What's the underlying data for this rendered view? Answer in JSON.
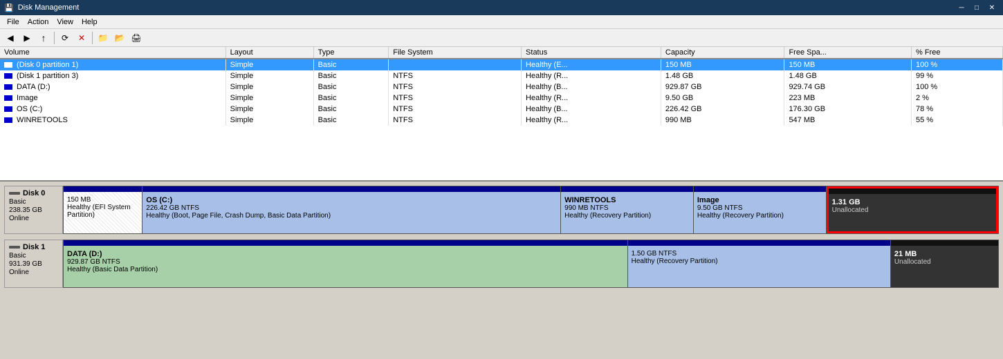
{
  "titleBar": {
    "title": "Disk Management",
    "minimize": "─",
    "maximize": "□",
    "close": "✕"
  },
  "menuBar": {
    "items": [
      "File",
      "Action",
      "View",
      "Help"
    ]
  },
  "toolbar": {
    "buttons": [
      "◀",
      "▶",
      "↑",
      "⬛",
      "✕",
      "📁",
      "📂",
      "🖨"
    ]
  },
  "table": {
    "columns": [
      "Volume",
      "Layout",
      "Type",
      "File System",
      "Status",
      "Capacity",
      "Free Spa...",
      "% Free"
    ],
    "rows": [
      {
        "volume": "(Disk 0 partition 1)",
        "layout": "Simple",
        "type": "Basic",
        "fs": "",
        "status": "Healthy (E...",
        "capacity": "150 MB",
        "free": "150 MB",
        "pct": "100 %",
        "selected": true
      },
      {
        "volume": "(Disk 1 partition 3)",
        "layout": "Simple",
        "type": "Basic",
        "fs": "NTFS",
        "status": "Healthy (R...",
        "capacity": "1.48 GB",
        "free": "1.48 GB",
        "pct": "99 %",
        "selected": false
      },
      {
        "volume": "DATA (D:)",
        "layout": "Simple",
        "type": "Basic",
        "fs": "NTFS",
        "status": "Healthy (B...",
        "capacity": "929.87 GB",
        "free": "929.74 GB",
        "pct": "100 %",
        "selected": false
      },
      {
        "volume": "Image",
        "layout": "Simple",
        "type": "Basic",
        "fs": "NTFS",
        "status": "Healthy (R...",
        "capacity": "9.50 GB",
        "free": "223 MB",
        "pct": "2 %",
        "selected": false
      },
      {
        "volume": "OS (C:)",
        "layout": "Simple",
        "type": "Basic",
        "fs": "NTFS",
        "status": "Healthy (B...",
        "capacity": "226.42 GB",
        "free": "176.30 GB",
        "pct": "78 %",
        "selected": false
      },
      {
        "volume": "WINRETOOLS",
        "layout": "Simple",
        "type": "Basic",
        "fs": "NTFS",
        "status": "Healthy (R...",
        "capacity": "990 MB",
        "free": "547 MB",
        "pct": "55 %",
        "selected": false
      }
    ]
  },
  "disk0": {
    "label": "Disk 0",
    "type": "Basic",
    "size": "238.35 GB",
    "status": "Online",
    "partitions": [
      {
        "id": "efi",
        "name": "",
        "size": "150 MB",
        "fs": "",
        "status": "Healthy (EFI System Partition)",
        "widthPct": 8
      },
      {
        "id": "os",
        "name": "OS (C:)",
        "size": "226.42 GB NTFS",
        "fs": "NTFS",
        "status": "Healthy (Boot, Page File, Crash Dump, Basic Data Partition)",
        "widthPct": 46
      },
      {
        "id": "winretools",
        "name": "WINRETOOLS",
        "size": "990 MB NTFS",
        "fs": "NTFS",
        "status": "Healthy (Recovery Partition)",
        "widthPct": 14
      },
      {
        "id": "image",
        "name": "Image",
        "size": "9.50 GB NTFS",
        "fs": "NTFS",
        "status": "Healthy (Recovery Partition)",
        "widthPct": 14
      },
      {
        "id": "unallocated",
        "name": "1.31 GB",
        "size": "Unallocated",
        "fs": "",
        "status": "",
        "widthPct": 18,
        "highlighted": true
      }
    ]
  },
  "disk1": {
    "label": "Disk 1",
    "type": "Basic",
    "size": "931.39 GB",
    "status": "Online",
    "partitions": [
      {
        "id": "data",
        "name": "DATA (D:)",
        "size": "929.87 GB NTFS",
        "fs": "NTFS",
        "status": "Healthy (Basic Data Partition)",
        "widthPct": 61
      },
      {
        "id": "recovery",
        "name": "",
        "size": "1.50 GB NTFS",
        "fs": "NTFS",
        "status": "Healthy (Recovery Partition)",
        "widthPct": 28
      },
      {
        "id": "unallocated2",
        "name": "21 MB",
        "size": "Unallocated",
        "fs": "",
        "status": "",
        "widthPct": 11
      }
    ]
  }
}
